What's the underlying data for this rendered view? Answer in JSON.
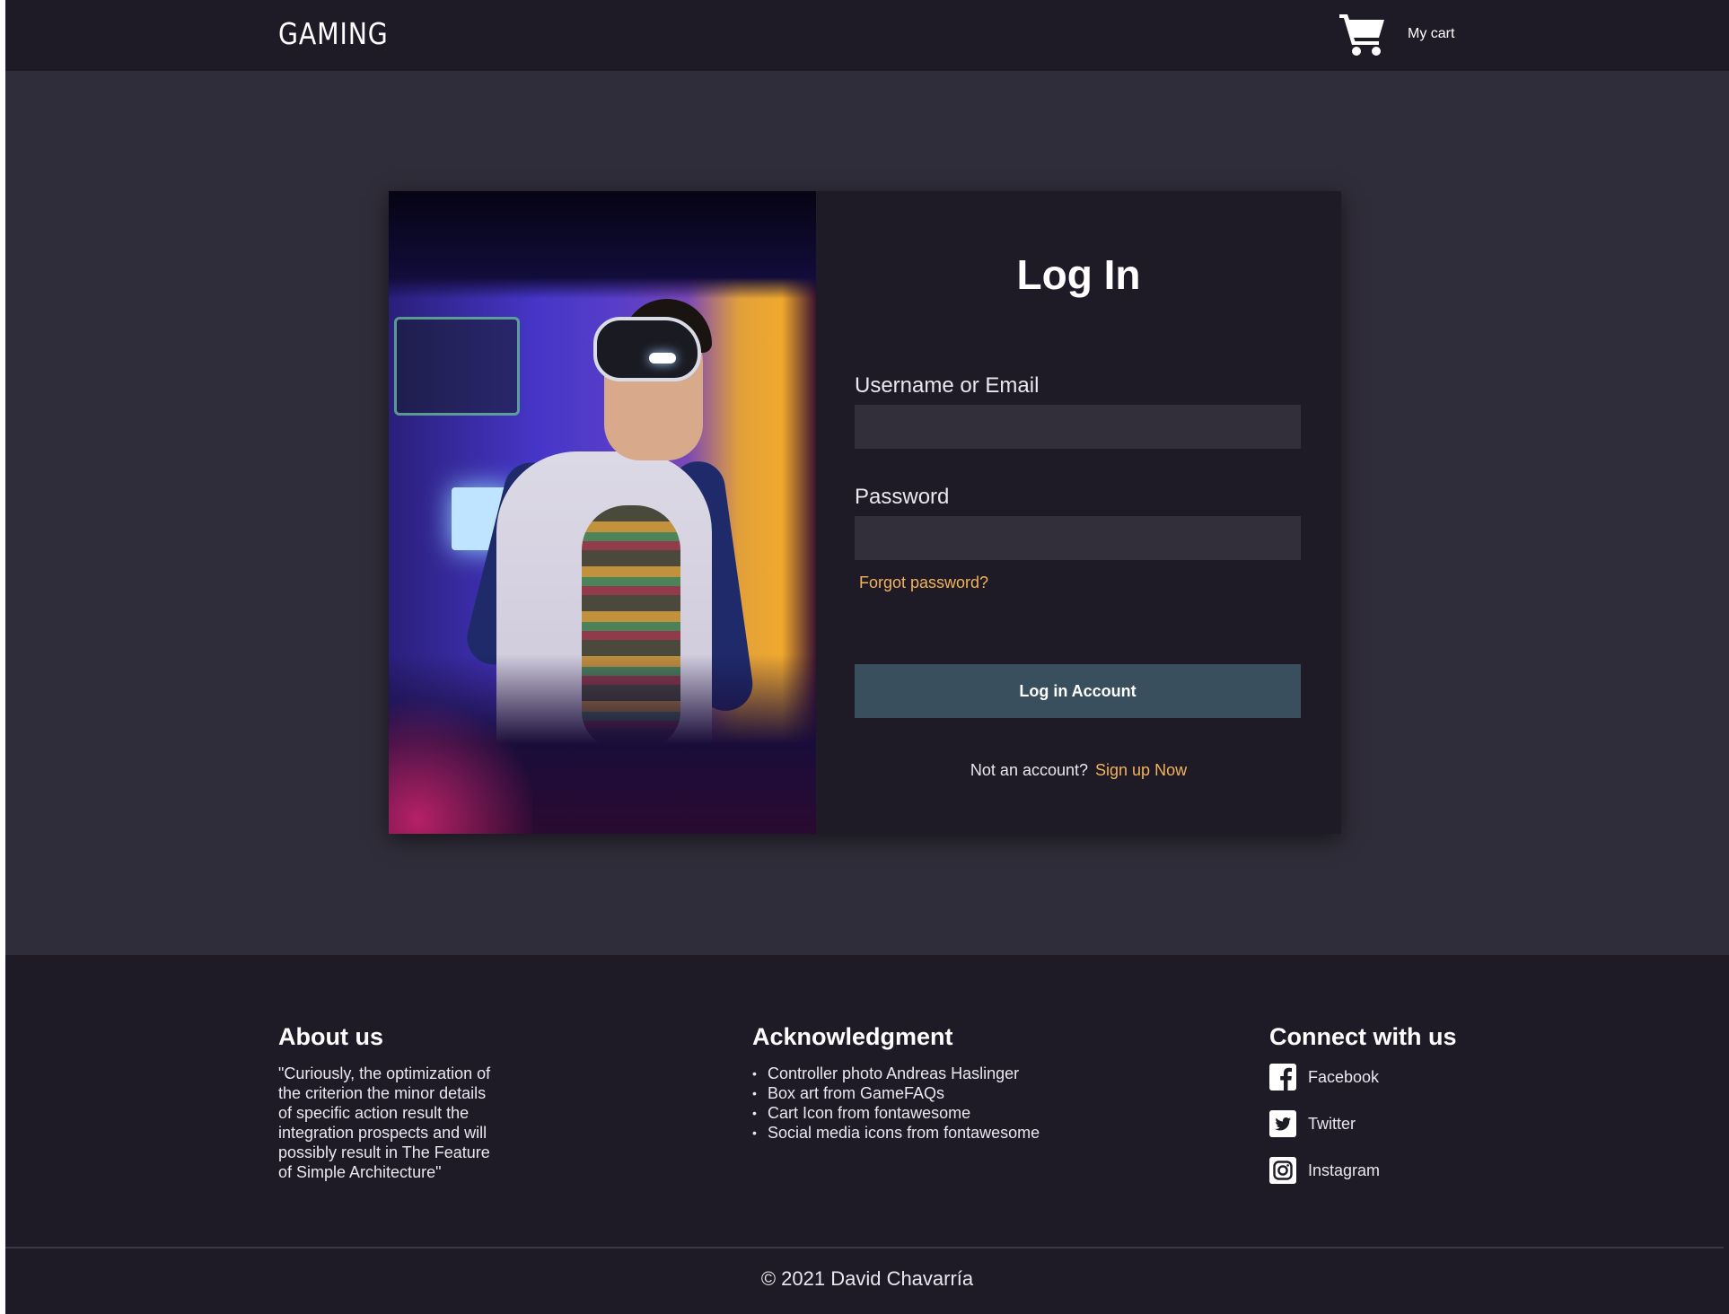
{
  "header": {
    "brand": "GAMING",
    "cart": {
      "label": "My cart",
      "icon": "cart-icon"
    }
  },
  "login": {
    "title": "Log In",
    "username_label": "Username or Email",
    "username_value": "",
    "password_label": "Password",
    "password_value": "",
    "forgot_link": "Forgot password?",
    "submit_label": "Log in Account",
    "signup_prompt": "Not an account?",
    "signup_link": "Sign up Now"
  },
  "footer": {
    "about": {
      "heading": "About us",
      "text": "\"Curiously, the optimization of the criterion the minor details of specific action result the integration prospects and will possibly result in The Feature of Simple Architecture\""
    },
    "acknowledgment": {
      "heading": "Acknowledgment",
      "items": [
        "Controller photo Andreas Haslinger",
        "Box art from GameFAQs",
        "Cart Icon from fontawesome",
        "Social media icons from fontawesome"
      ]
    },
    "connect": {
      "heading": "Connect with us",
      "items": [
        {
          "label": "Facebook",
          "icon": "facebook-icon"
        },
        {
          "label": "Twitter",
          "icon": "twitter-icon"
        },
        {
          "label": "Instagram",
          "icon": "instagram-icon"
        }
      ]
    },
    "copyright": "© 2021 David Chavarría"
  },
  "colors": {
    "background": "#302d3a",
    "panel": "#1e1b26",
    "input": "#322f3b",
    "accent_link": "#f2b35c",
    "button": "#3a4f5d"
  }
}
